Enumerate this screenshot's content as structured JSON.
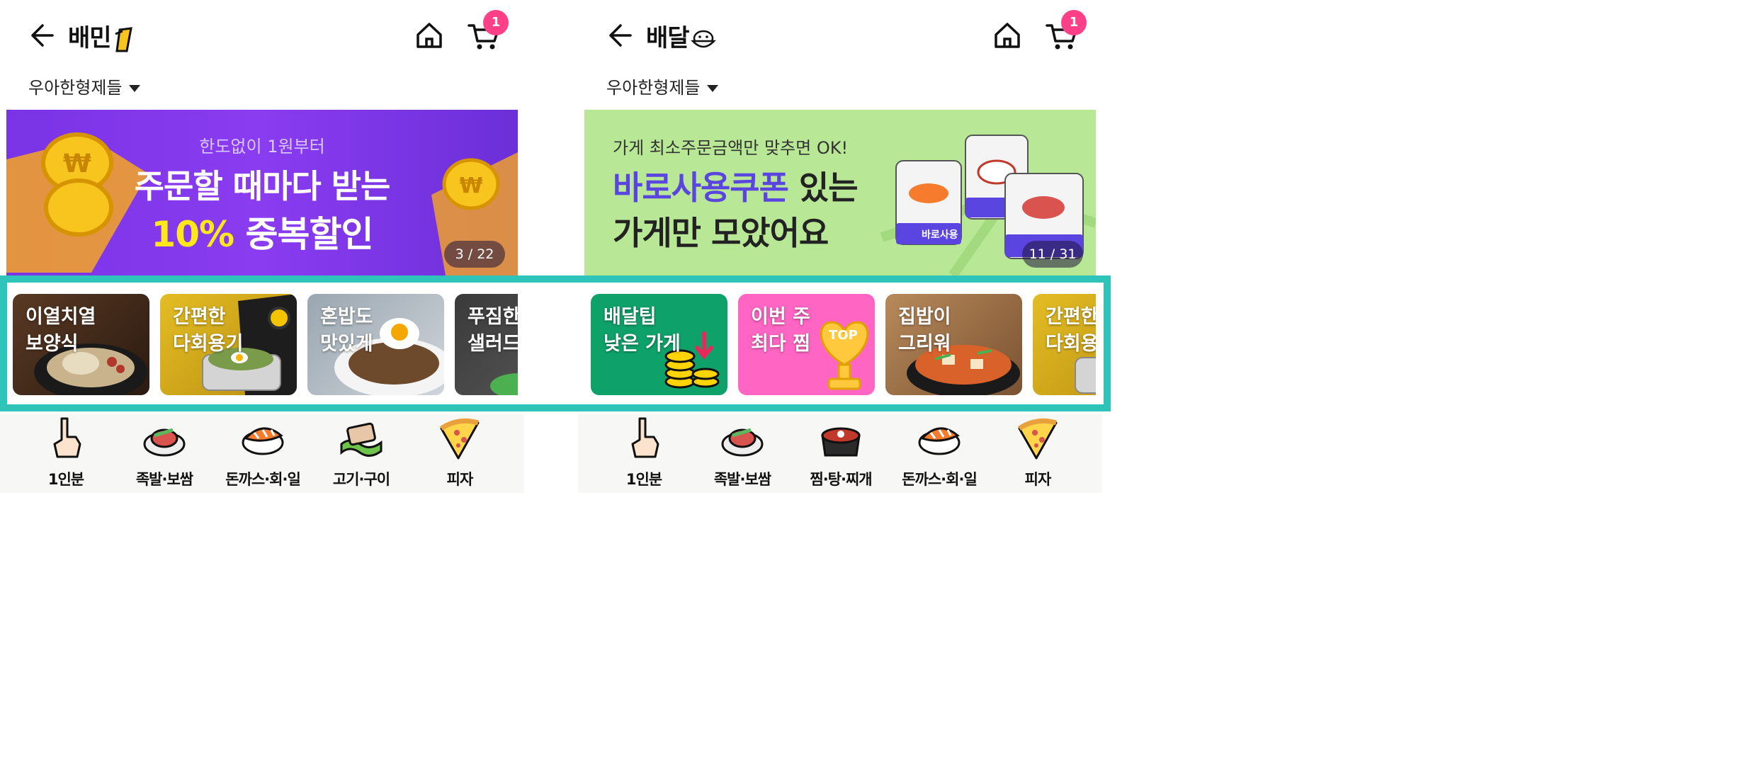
{
  "left": {
    "logo": "배민",
    "cart_count": "1",
    "address": "우아한형제들",
    "banner": {
      "line1": "한도없이 1원부터",
      "line2": "주문할 때마다 받는",
      "line3_highlight": "10%",
      "line3_rest": " 중복할인",
      "counter": "3 / 22"
    },
    "cards": [
      {
        "label": "이열치열\n보양식"
      },
      {
        "label": "간편한\n다회용기"
      },
      {
        "label": "혼밥도\n맛있게"
      },
      {
        "label": "푸짐한\n샐러드"
      }
    ],
    "categories": [
      {
        "label": "1인분",
        "icon": "hand-pointing-icon"
      },
      {
        "label": "족발·보쌈",
        "icon": "jokbal-icon"
      },
      {
        "label": "돈까스·회·일식",
        "icon": "sushi-icon"
      },
      {
        "label": "고기·구이",
        "icon": "meat-icon"
      },
      {
        "label": "피자",
        "icon": "pizza-icon"
      }
    ]
  },
  "right": {
    "logo": "배달",
    "cart_count": "1",
    "address": "우아한형제들",
    "banner": {
      "line1": "가게 최소주문금액만 맞추면 OK!",
      "line2_highlight": "바로사용쿠폰",
      "line2_rest": " 있는",
      "line3": "가게만 모았어요",
      "bag_label": "바로사용",
      "counter": "11 / 31"
    },
    "cards": [
      {
        "label": "배달팁\n낮은 가게"
      },
      {
        "label": "이번 주\n최다 찜"
      },
      {
        "label": "집밥이\n그리워"
      },
      {
        "label": "간편한\n다회용기"
      }
    ],
    "top_badge": "TOP",
    "categories": [
      {
        "label": "1인분",
        "icon": "hand-pointing-icon"
      },
      {
        "label": "족발·보쌈",
        "icon": "jokbal-icon"
      },
      {
        "label": "찜·탕·찌개",
        "icon": "stew-pot-icon"
      },
      {
        "label": "돈까스·회·일식",
        "icon": "sushi-icon"
      },
      {
        "label": "피자",
        "icon": "pizza-icon"
      }
    ]
  },
  "colors": {
    "highlight_border": "#2ec4ba",
    "cart_badge": "#ff3f88",
    "banner_left": "#7a33e6",
    "banner_right": "#b8e895",
    "coupon_text": "#5b45e0"
  }
}
